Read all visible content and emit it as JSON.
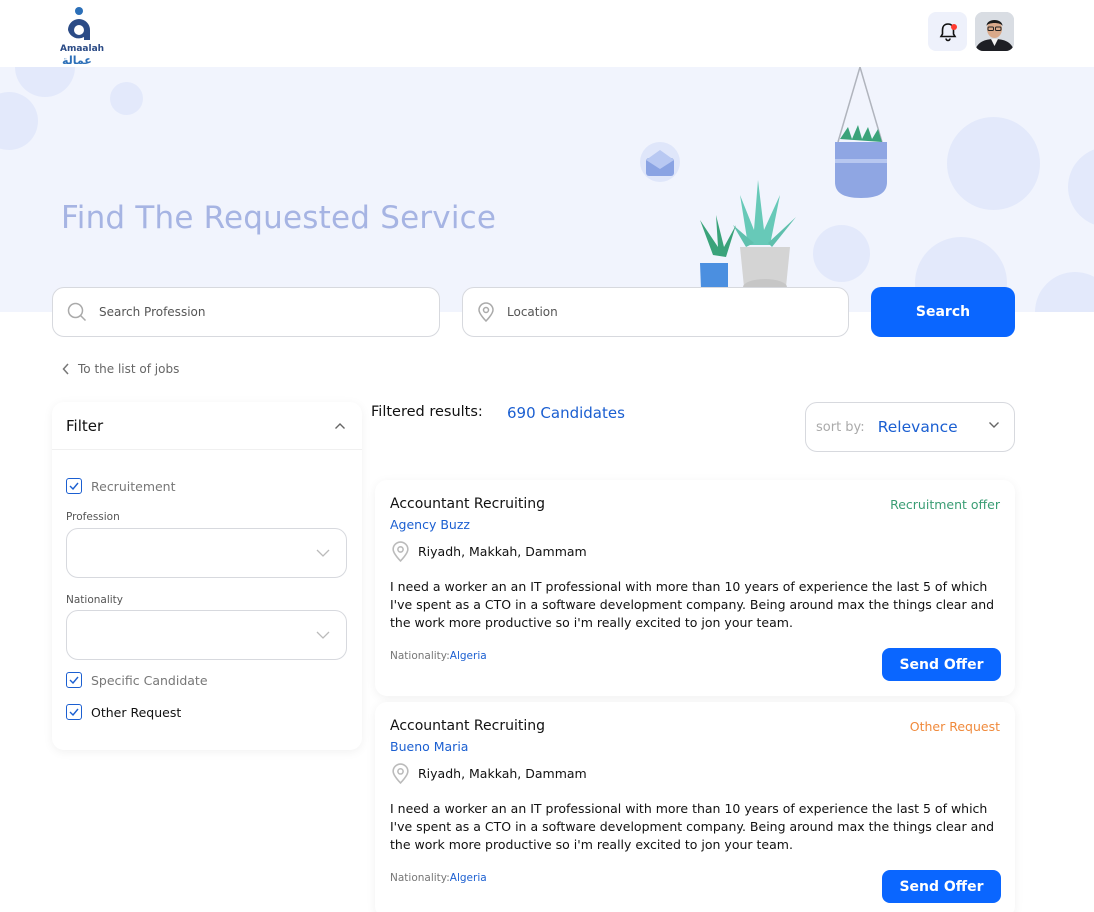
{
  "brand": {
    "name": "Amaalah",
    "arabic": "عمالة"
  },
  "hero": {
    "title": "Find The Requested Service"
  },
  "search": {
    "profession_placeholder": "Search Profession",
    "location_placeholder": "Location",
    "button_label": "Search"
  },
  "back_link": "To the list of jobs",
  "filter": {
    "title": "Filter",
    "recruitment_label": "Recruitement",
    "profession_label": "Profession",
    "nationality_label": "Nationality",
    "specific_candidate_label": "Specific Candidate",
    "other_request_label": "Other Request"
  },
  "results": {
    "label": "Filtered results:",
    "count": "690 Candidates",
    "sort_label": "sort by:",
    "sort_value": "Relevance"
  },
  "cards": [
    {
      "title": "Accountant Recruiting",
      "company": "Agency Buzz",
      "badge": "Recruitment offer",
      "badge_color": "#3a9d74",
      "location": "Riyadh, Makkah, Dammam",
      "description": "I need a worker an an IT professional with more than 10 years of experience the last 5 of which I've spent as a CTO in a software development company. Being around max the things clear and the work more productive so i'm really excited to jon your team.",
      "nationality_label": "Nationality:",
      "nationality": "Algeria",
      "button_label": "Send Offer"
    },
    {
      "title": "Accountant Recruiting",
      "company": "Bueno Maria",
      "badge": "Other Request",
      "badge_color": "#f08a3c",
      "location": "Riyadh, Makkah, Dammam",
      "description": "I need a worker an an IT professional with more than 10 years of experience the last 5 of which I've spent as a CTO in a software development company. Being around max the things clear and the work more productive so i'm really excited to jon your team.",
      "nationality_label": "Nationality:",
      "nationality": "Algeria",
      "button_label": "Send Offer"
    }
  ],
  "colors": {
    "primary": "#0a66ff",
    "link": "#1b5fd1",
    "hero_bg": "#f1f4fd"
  }
}
